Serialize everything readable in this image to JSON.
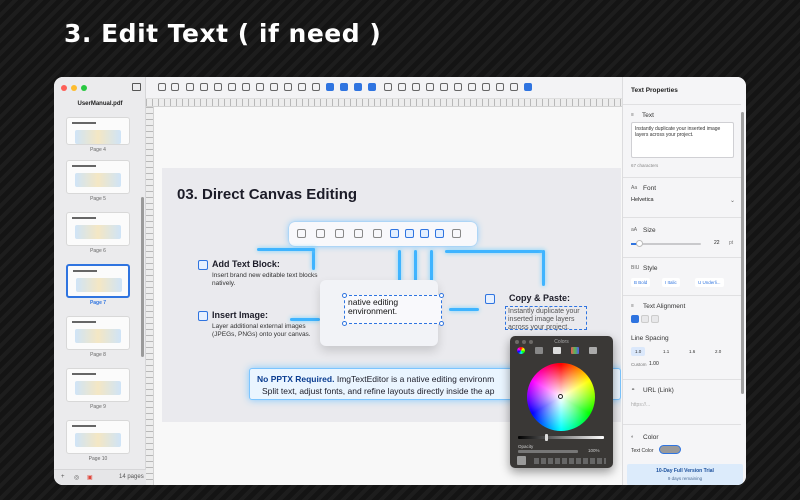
{
  "hero": {
    "title": "3. Edit Text ( if need )"
  },
  "app": {
    "document_name": "UserManual.pdf",
    "page_count": "14 pages"
  },
  "sidebar": {
    "pages": [
      {
        "label": "Page 4"
      },
      {
        "label": "Page 5"
      },
      {
        "label": "Page 6"
      },
      {
        "label": "Page 7",
        "selected": true
      },
      {
        "label": "Page 8"
      },
      {
        "label": "Page 9"
      },
      {
        "label": "Page 10"
      }
    ]
  },
  "slide": {
    "title": "03. Direct Canvas Editing",
    "features": [
      {
        "title": "Add Text Block:",
        "desc": "Insert brand new editable text blocks natively."
      },
      {
        "title": "Insert Image:",
        "desc": "Layer additional external images (JPEGs, PNGs) onto your canvas."
      },
      {
        "title": "Copy & Paste:",
        "desc": "Instantly duplicate your inserted image layers across your project."
      }
    ],
    "edit_text": "native editing environment.",
    "banner_bold": "No PPTX Required.",
    "banner_line1": " ImgTextEditor is a native editing environm",
    "banner_line2": "Split text, adjust fonts, and refine layouts directly inside the ap"
  },
  "color_picker": {
    "title": "Colors",
    "opacity_label": "Opacity",
    "opacity_value": "100%"
  },
  "properties": {
    "title": "Text Properties",
    "text": {
      "header": "Text",
      "value": "Instantly duplicate your inserted image layers across your project.",
      "char_count": "67 characters"
    },
    "font": {
      "header": "Font",
      "value": "Helvetica"
    },
    "size": {
      "header": "Size",
      "value": "22",
      "unit": "pt",
      "level": 0.1
    },
    "style": {
      "header": "Style",
      "bold": "B  Bold",
      "italic": "I  Italic",
      "underline": "U  Underli..."
    },
    "alignment": {
      "header": "Text Alignment"
    },
    "line_spacing": {
      "header": "Line Spacing",
      "options": [
        "1.0",
        "1.1",
        "1.6",
        "2.0"
      ],
      "custom_label": "Custom",
      "custom_value": "1.00"
    },
    "url": {
      "header": "URL (Link)",
      "placeholder": "https://..."
    },
    "color": {
      "header": "Color",
      "label": "Text Color",
      "value": "#9a9a9a"
    },
    "trial": {
      "title": "10-Day Full Version Trial",
      "subtitle": "9 days remaining"
    }
  }
}
